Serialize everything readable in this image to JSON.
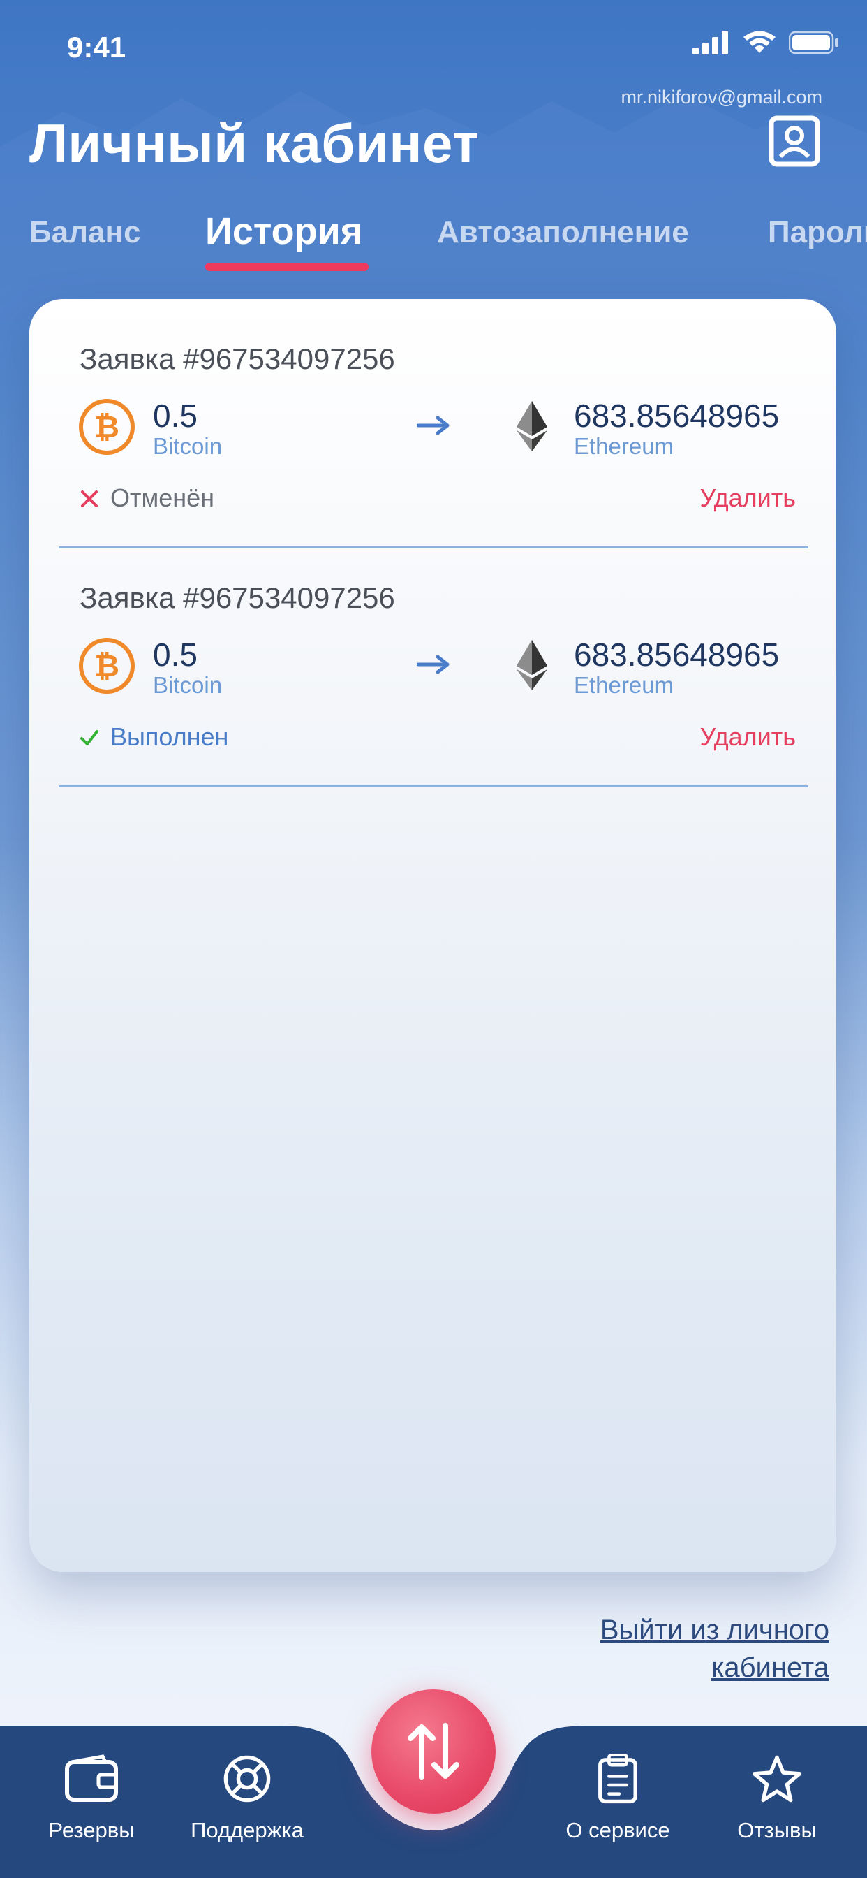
{
  "status_bar": {
    "time": "9:41"
  },
  "header": {
    "email": "mr.nikiforov@gmail.com",
    "title": "Личный кабинет"
  },
  "tabs": [
    {
      "label": "Баланс",
      "active": false
    },
    {
      "label": "История",
      "active": true
    },
    {
      "label": "Автозаполнение",
      "active": false
    },
    {
      "label": "Пароль",
      "active": false
    }
  ],
  "orders": [
    {
      "title": "Заявка #967534097256",
      "from_amount": "0.5",
      "from_currency": "Bitcoin",
      "to_amount": "683.85648965",
      "to_currency": "Ethereum",
      "status": "Отменён",
      "delete_label": "Удалить"
    },
    {
      "title": "Заявка #967534097256",
      "from_amount": "0.5",
      "from_currency": "Bitcoin",
      "to_amount": "683.85648965",
      "to_currency": "Ethereum",
      "status": "Выполнен",
      "delete_label": "Удалить"
    }
  ],
  "logout": {
    "line1": "Выйти из личного",
    "line2": "кабинета"
  },
  "bottom_nav": {
    "reserves": "Резервы",
    "support": "Поддержка",
    "about": "О сервисе",
    "reviews": "Отзывы"
  },
  "colors": {
    "accent": "#e84867",
    "primary_blue": "#3f76c4",
    "nav_bg": "#25487f",
    "bitcoin": "#f0892a",
    "success": "#34b233",
    "danger": "#e53e5f"
  },
  "icons": [
    "signal-icon",
    "wifi-icon",
    "battery-icon",
    "profile-icon",
    "bitcoin-icon",
    "arrow-right-icon",
    "ethereum-icon",
    "close-icon",
    "check-icon",
    "wallet-icon",
    "lifebuoy-icon",
    "exchange-icon",
    "clipboard-icon",
    "star-icon"
  ]
}
